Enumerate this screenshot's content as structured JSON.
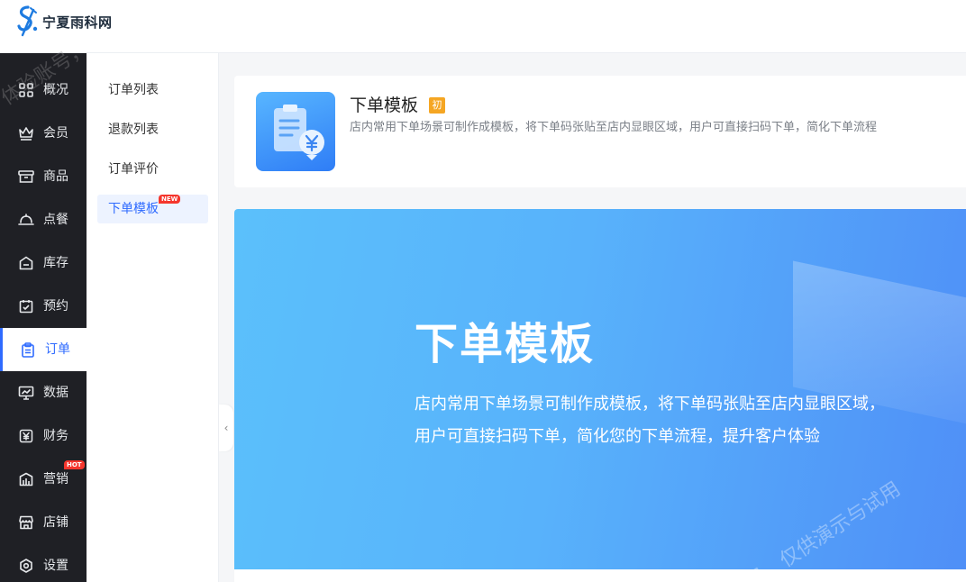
{
  "brand": {
    "name": "宁夏雨科网",
    "logo_color": "#1e7be0"
  },
  "main_nav": [
    {
      "label": "概况",
      "icon": "grid-icon"
    },
    {
      "label": "会员",
      "icon": "crown-icon"
    },
    {
      "label": "商品",
      "icon": "box-icon"
    },
    {
      "label": "点餐",
      "icon": "cloche-icon"
    },
    {
      "label": "库存",
      "icon": "warehouse-icon"
    },
    {
      "label": "预约",
      "icon": "calendar-check-icon"
    },
    {
      "label": "订单",
      "icon": "clipboard-icon",
      "active": true
    },
    {
      "label": "数据",
      "icon": "chart-monitor-icon"
    },
    {
      "label": "财务",
      "icon": "yen-icon"
    },
    {
      "label": "营销",
      "icon": "campaign-icon",
      "tag": "HOT"
    },
    {
      "label": "店铺",
      "icon": "store-icon"
    },
    {
      "label": "设置",
      "icon": "settings-icon"
    }
  ],
  "sub_nav": [
    {
      "label": "订单列表"
    },
    {
      "label": "退款列表"
    },
    {
      "label": "订单评价"
    },
    {
      "label": "下单模板",
      "active": true,
      "tag": "NEW"
    }
  ],
  "card": {
    "title": "下单模板",
    "badge": "初",
    "description": "店内常用下单场景可制作成模板，将下单码张贴至店内显眼区域，用户可直接扫码下单，简化下单流程",
    "icon": "template-yen-icon"
  },
  "banner": {
    "title": "下单模板",
    "line1": "店内常用下单场景可制作成模板，将下单码张贴至店内显眼区域，",
    "line2": "用户可直接扫码下单，简化您的下单流程，提升客户体验"
  },
  "watermark": {
    "text1": "体验账号，",
    "text2": "账号，仅供演示与试用"
  },
  "colors": {
    "accent": "#2f6bff",
    "nav_bg": "#1f2025",
    "banner_start": "#5bc0fb",
    "banner_end": "#4f8ff7",
    "hot": "#f5362d"
  }
}
